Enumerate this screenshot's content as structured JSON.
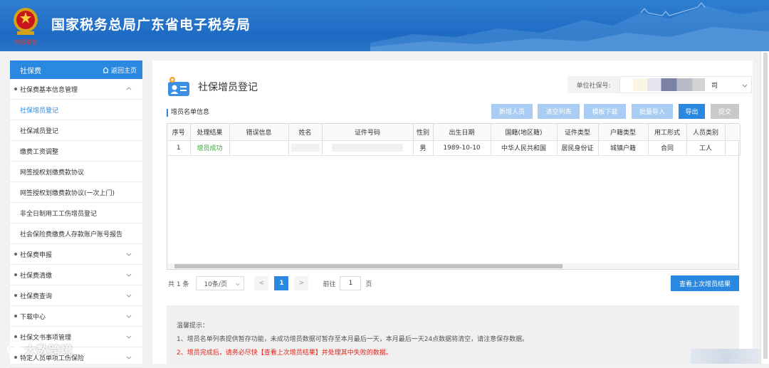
{
  "header": {
    "title": "国家税务总局广东省电子税务局",
    "emblem_text": "中国税务"
  },
  "sidebar": {
    "section": "社保费",
    "home_link": "返回主页",
    "items": [
      {
        "label": "社保费基本信息管理",
        "type": "group",
        "expanded": true
      },
      {
        "label": "社保增员登记",
        "type": "sub",
        "active": true
      },
      {
        "label": "社保减员登记",
        "type": "sub"
      },
      {
        "label": "缴费工资调整",
        "type": "sub"
      },
      {
        "label": "网签授权划缴费款协议",
        "type": "sub"
      },
      {
        "label": "网签授权划缴费款协议(一次上门)",
        "type": "sub"
      },
      {
        "label": "非全日制用工工伤增员登记",
        "type": "sub"
      },
      {
        "label": "社会保险费缴费人存款账户账号报告",
        "type": "sub"
      },
      {
        "label": "社保费申报",
        "type": "group"
      },
      {
        "label": "社保费清缴",
        "type": "group"
      },
      {
        "label": "社保费查询",
        "type": "group"
      },
      {
        "label": "下载中心",
        "type": "group"
      },
      {
        "label": "社保文书事项管理",
        "type": "group"
      },
      {
        "label": "特定人员单项工伤保险",
        "type": "group"
      }
    ]
  },
  "main": {
    "title": "社保增员登记",
    "unit_label": "单位社保号:",
    "unit_value_suffix": "司",
    "section_label": "增员名单信息",
    "buttons": {
      "add": "新增人员",
      "clear": "清空列表",
      "template": "模板下载",
      "import": "批量导入",
      "export": "导出",
      "submit": "提交"
    },
    "table": {
      "columns": [
        "序号",
        "处理结果",
        "错误信息",
        "姓名",
        "证件号码",
        "性别",
        "出生日期",
        "国籍(地区籍)",
        "证件类型",
        "户籍类型",
        "用工形式",
        "人员类别"
      ],
      "rows": [
        {
          "index": "1",
          "result": "增员成功",
          "error": "",
          "name": "",
          "id_number": "",
          "gender": "男",
          "birth": "1989-10-10",
          "nationality": "中华人民共和国",
          "id_type": "居民身份证",
          "household": "城镇户籍",
          "employment": "合同",
          "category": "工人"
        }
      ]
    },
    "pager": {
      "total": "共 1 条",
      "page_size": "10条/页",
      "current": "1",
      "goto": "前往",
      "goto_value": "1",
      "page_unit": "页",
      "prev": "<",
      "next": ">"
    },
    "last_result_button": "查看上次增员结果",
    "notice": {
      "title": "温馨提示：",
      "line1": "1、增员名单列表提供暂存功能，未成功增员数据可暂存至本月最后一天，本月最后一天24点数据将清空，请注意保存数据。",
      "line2": "2、增员完成后，请务必尽快【查看上次增员结果】并处理其中失败的数据。"
    }
  },
  "watermark": "大数跨境",
  "colors": {
    "primary": "#2a88e0",
    "light_button": "#a9cdf2",
    "success": "#3aa335",
    "warning": "#e2231a"
  }
}
